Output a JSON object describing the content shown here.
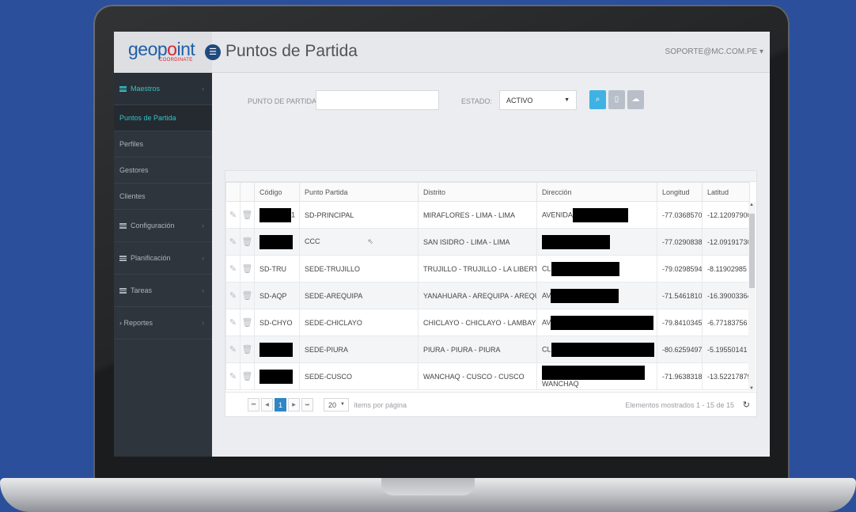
{
  "app": {
    "logo_main_start": "geop",
    "logo_dot": "o",
    "logo_main_end": "int",
    "logo_sub": "COORDINATE",
    "page_title": "Puntos de Partida",
    "user": "SOPORTE@MC.COM.PE"
  },
  "sidebar": {
    "items": [
      {
        "label": "Maestros"
      },
      {
        "label": "Puntos de Partida"
      },
      {
        "label": "Perfiles"
      },
      {
        "label": "Gestores"
      },
      {
        "label": "Clientes"
      },
      {
        "label": "Configuración"
      },
      {
        "label": "Planificación"
      },
      {
        "label": "Tareas"
      },
      {
        "label": "Reportes"
      }
    ]
  },
  "filters": {
    "punto_label": "PUNTO DE PARTIDA:",
    "punto_value": "",
    "estado_label": "ESTADO:",
    "estado_value": "ACTIVO"
  },
  "table": {
    "headers": [
      "Código",
      "Punto Partida",
      "Distrito",
      "Dirección",
      "Longitud",
      "Latitud"
    ],
    "rows": [
      {
        "codigo": "1",
        "punto": "SD-PRINCIPAL",
        "distrito": "MIRAFLORES - LIMA - LIMA",
        "direccion": "AVENIDA",
        "longitud": "-77.03685700",
        "latitud": "-12.12097900"
      },
      {
        "codigo": "",
        "punto": "CCC",
        "distrito": "SAN ISIDRO - LIMA - LIMA",
        "direccion": "",
        "longitud": "-77.02908380",
        "latitud": "-12.09191730"
      },
      {
        "codigo": "SD-TRU",
        "punto": "SEDE-TRUJILLO",
        "distrito": "TRUJILLO - TRUJILLO - LA LIBERTAD",
        "direccion": "CL",
        "longitud": "-79.02985940",
        "latitud": "-8.11902985"
      },
      {
        "codigo": "SD-AQP",
        "punto": "SEDE-AREQUIPA",
        "distrito": "YANAHUARA - AREQUIPA - AREQUIPA",
        "direccion": "AV",
        "longitud": "-71.54618107",
        "latitud": "-16.39003364"
      },
      {
        "codigo": "SD-CHYO",
        "punto": "SEDE-CHICLAYO",
        "distrito": "CHICLAYO - CHICLAYO - LAMBAYEQUE",
        "direccion": "AV",
        "longitud": "-79.84103457",
        "latitud": "-6.77183756"
      },
      {
        "codigo": "",
        "punto": "SEDE-PIURA",
        "distrito": "PIURA - PIURA - PIURA",
        "direccion": "CL",
        "longitud": "-80.62594978",
        "latitud": "-5.19550141"
      },
      {
        "codigo": "",
        "punto": "SEDE-CUSCO",
        "distrito": "WANCHAQ - CUSCO - CUSCO",
        "direccion": "WANCHAQ",
        "longitud": "-71.96383189",
        "latitud": "-13.52217879"
      }
    ]
  },
  "pager": {
    "current_page": "1",
    "page_size": "20",
    "per_page_label": "ítems por página",
    "summary": "Elementos mostrados 1 - 15 de 15"
  },
  "colors": {
    "accent": "#34c3c8",
    "button_blue": "#3fb2e3",
    "page_blue": "#2f86c5",
    "background": "#2b4f9b"
  }
}
